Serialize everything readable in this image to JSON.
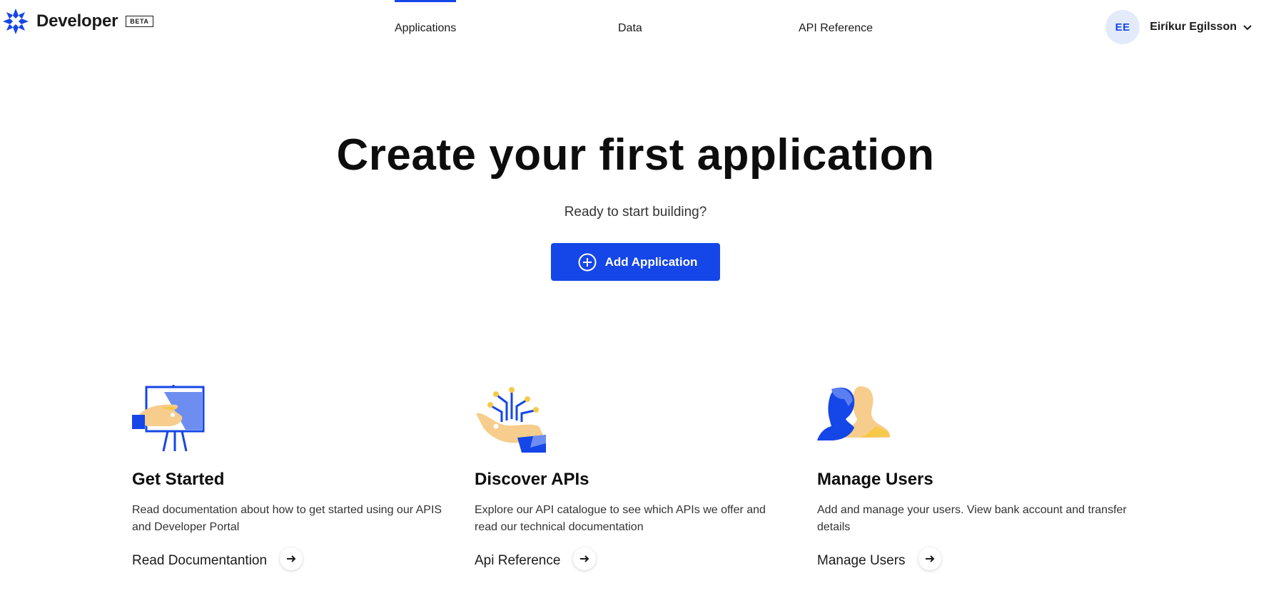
{
  "header": {
    "logo_text": "Developer",
    "beta_label": "BETA",
    "nav": [
      {
        "label": "Applications",
        "active": true
      },
      {
        "label": "Data",
        "active": false
      },
      {
        "label": "API Reference",
        "active": false
      }
    ],
    "user": {
      "initials": "EE",
      "name": "Eiríkur Egilsson"
    }
  },
  "hero": {
    "title": "Create your first application",
    "subtitle": "Ready to start building?",
    "button_label": "Add Application"
  },
  "cards": [
    {
      "icon": "presentation-easel-icon",
      "title": "Get Started",
      "description": "Read documentation about how to get started using our APIS and Developer Portal",
      "link_label": "Read Documentantion"
    },
    {
      "icon": "hand-api-icon",
      "title": "Discover APIs",
      "description": "Explore our API catalogue to see which APIs we offer and read our technical documentation",
      "link_label": "Api Reference"
    },
    {
      "icon": "users-icon",
      "title": "Manage Users",
      "description": "Add and manage your users. View bank account and transfer details",
      "link_label": "Manage Users"
    }
  ],
  "colors": {
    "accent": "#1546e8",
    "avatar_bg": "#e3ebfb",
    "illustration_yellow": "#f7c948",
    "illustration_light_blue": "#5b7ff0"
  }
}
